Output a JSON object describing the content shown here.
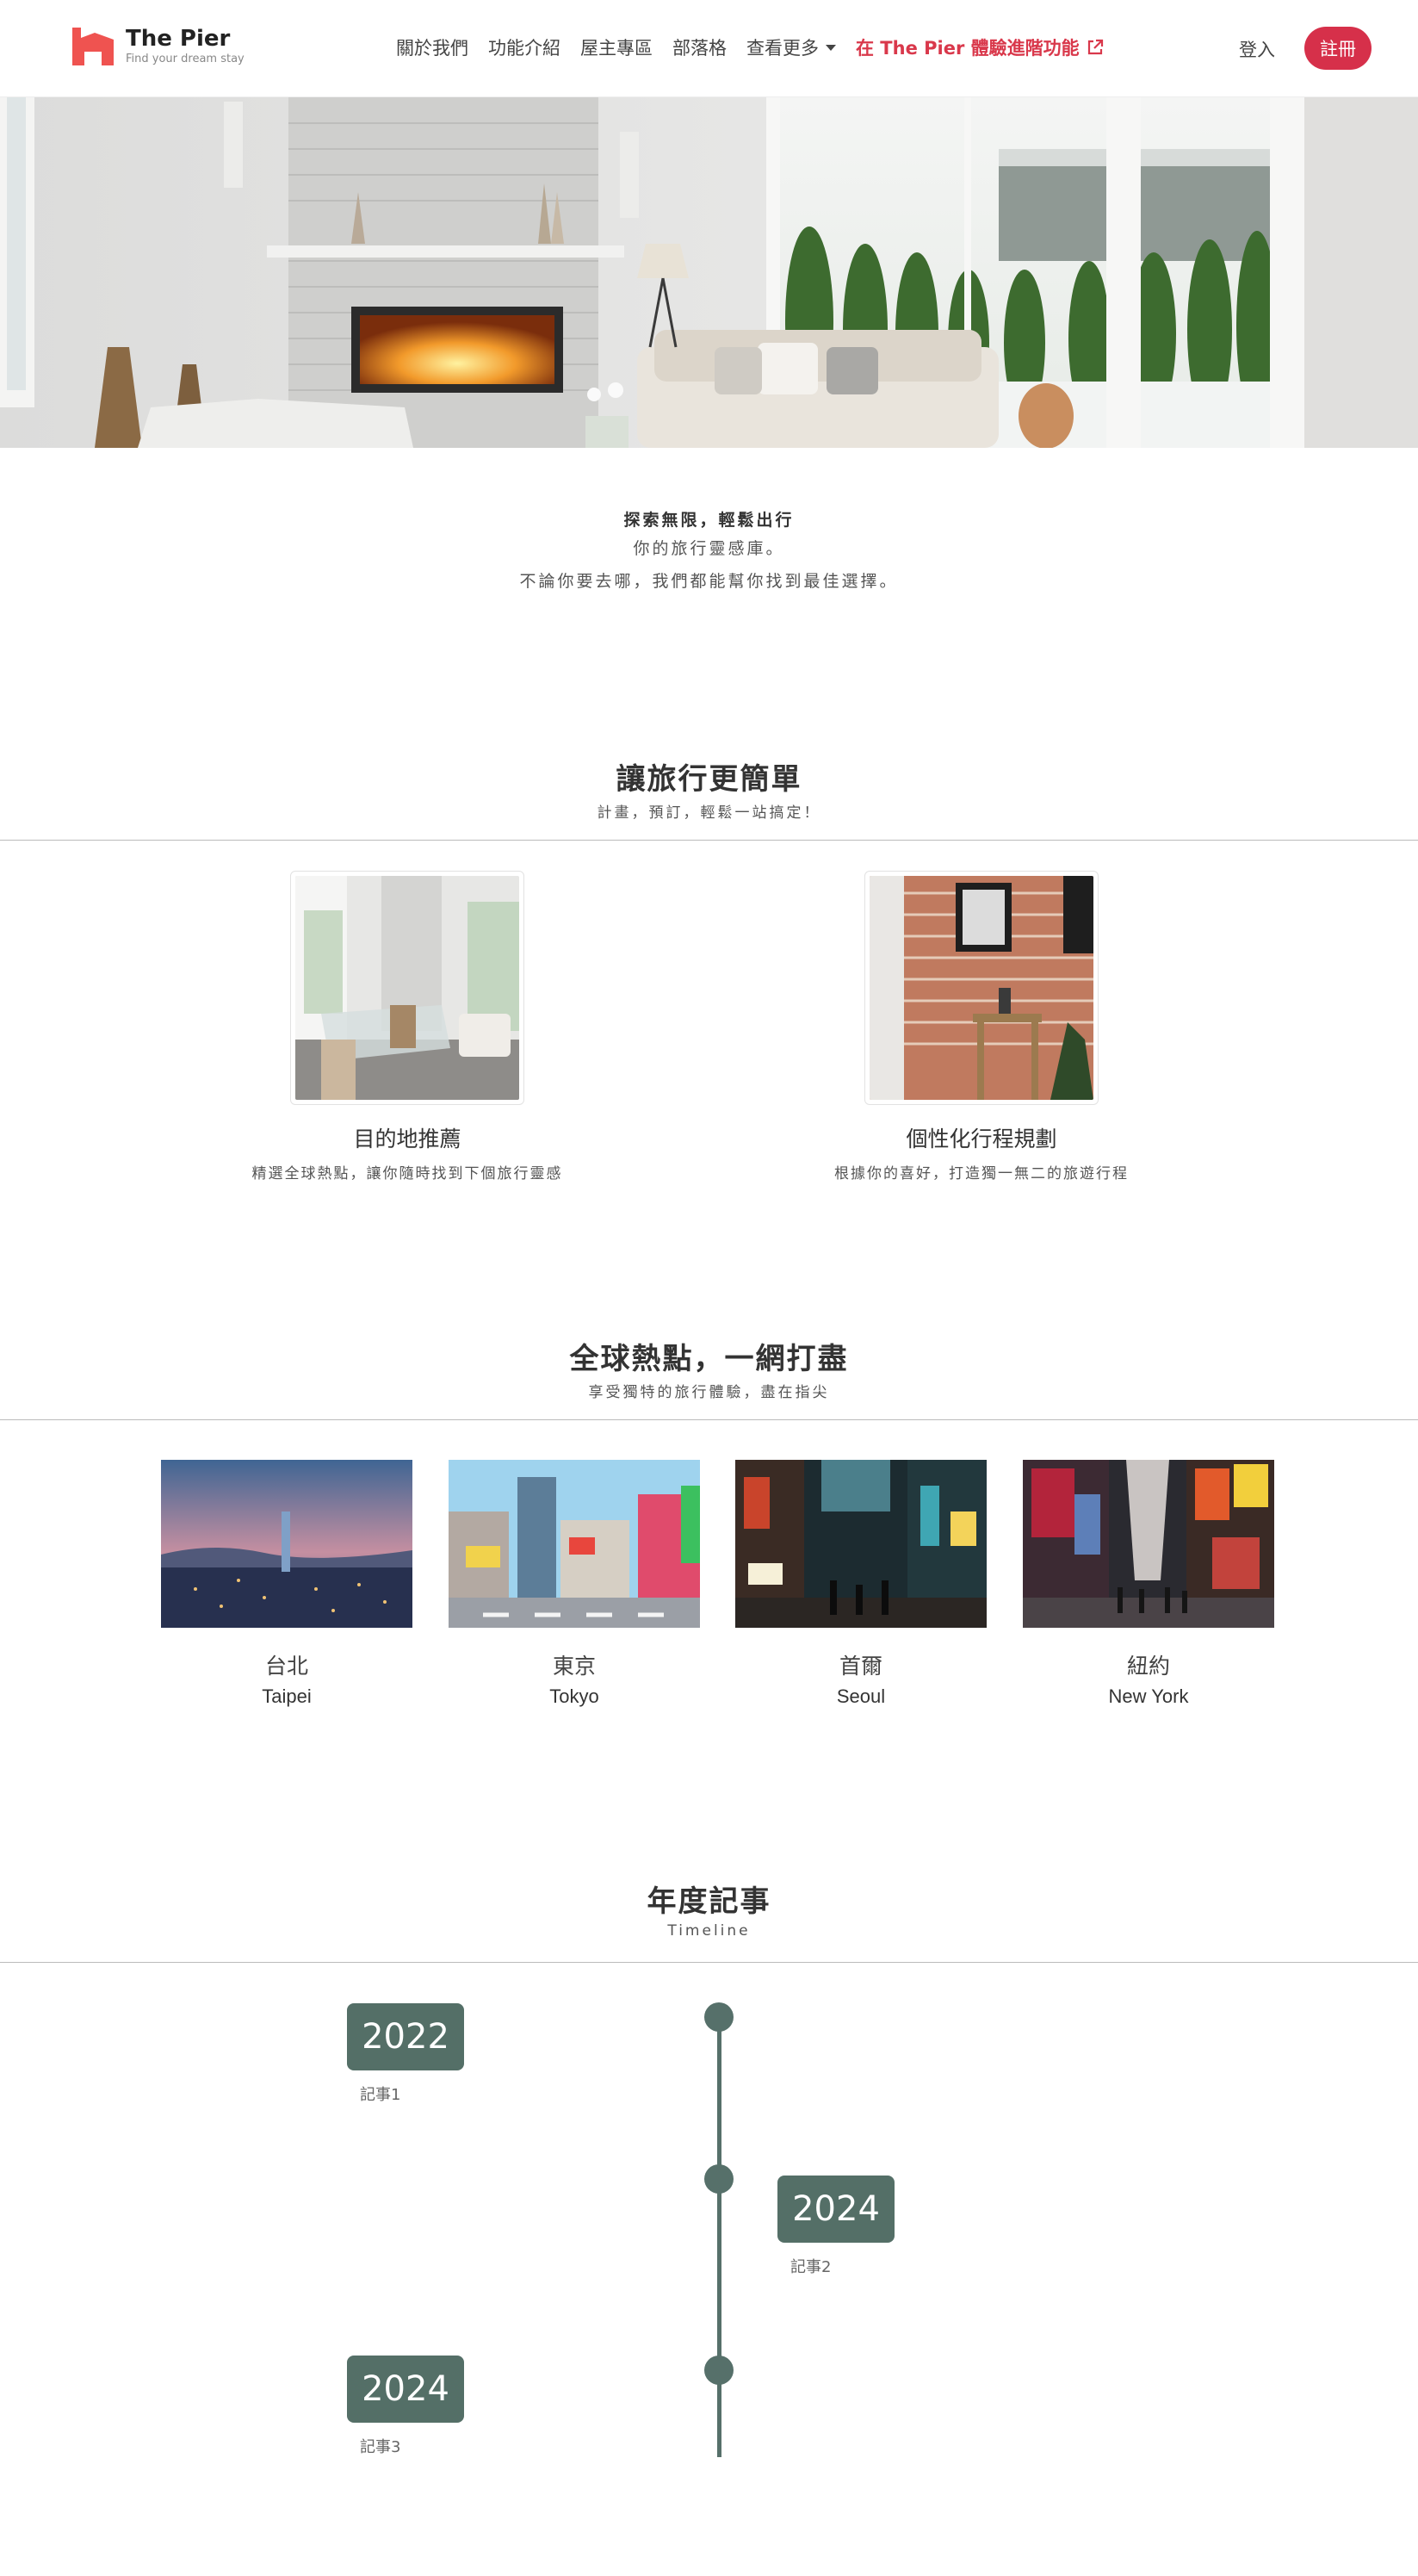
{
  "brand": {
    "name": "The Pier",
    "tagline": "Find your dream stay",
    "color": "#ef5350"
  },
  "nav": {
    "links": [
      "關於我們",
      "功能介紹",
      "屋主專區",
      "部落格"
    ],
    "more": "查看更多",
    "feature": "在 The Pier 體驗進階功能",
    "feature_icon": "external-link-icon",
    "login": "登入",
    "signup": "註冊"
  },
  "hero": {
    "image": "living-room-fireplace-photo"
  },
  "intro": {
    "line1": "探索無限，輕鬆出行",
    "line2": "你的旅行靈感庫。",
    "line3": "不論你要去哪，我們都能幫你找到最佳選擇。"
  },
  "section_simple": {
    "title": "讓旅行更簡單",
    "subtitle": "計畫，預訂，輕鬆一站搞定！",
    "cards": [
      {
        "title": "目的地推薦",
        "desc": "精選全球熱點，讓你隨時找到下個旅行靈感",
        "image": "dining-room-photo"
      },
      {
        "title": "個性化行程規劃",
        "desc": "根據你的喜好，打造獨一無二的旅遊行程",
        "image": "brick-wall-interior-photo"
      }
    ]
  },
  "section_cities": {
    "title": "全球熱點，一網打盡",
    "subtitle": "享受獨特的旅行體驗，盡在指尖",
    "cities": [
      {
        "zh": "台北",
        "en": "Taipei",
        "image": "taipei-skyline-photo"
      },
      {
        "zh": "東京",
        "en": "Tokyo",
        "image": "tokyo-street-photo"
      },
      {
        "zh": "首爾",
        "en": "Seoul",
        "image": "seoul-night-street-photo"
      },
      {
        "zh": "紐約",
        "en": "New York",
        "image": "new-york-times-square-photo"
      }
    ]
  },
  "section_timeline": {
    "title": "年度記事",
    "subtitle": "Timeline",
    "accent": "#546f67",
    "events": [
      {
        "year": "2022",
        "note": "記事1",
        "side": "left"
      },
      {
        "year": "2024",
        "note": "記事2",
        "side": "right"
      },
      {
        "year": "2024",
        "note": "記事3",
        "side": "left"
      }
    ]
  }
}
